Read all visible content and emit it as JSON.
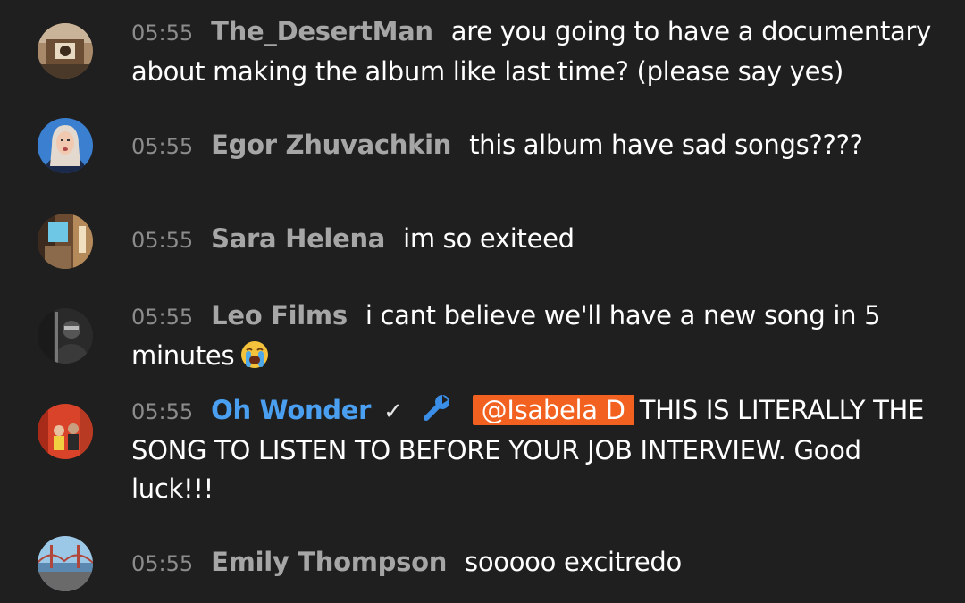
{
  "messages": [
    {
      "time": "05:55",
      "author": "The_DesertMan",
      "text": "are you going to have a documentary about making the album like last time? (please say yes)"
    },
    {
      "time": "05:55",
      "author": "Egor Zhuvachkin",
      "text": "this album have sad songs????"
    },
    {
      "time": "05:55",
      "author": "Sara Helena",
      "text": "im so exiteed"
    },
    {
      "time": "05:55",
      "author": "Leo Films",
      "text": "i cant believe we'll have a new song in 5 minutes",
      "emoji": "loudly-crying-face-icon"
    },
    {
      "time": "05:55",
      "author": "Oh Wonder",
      "verified": "✓",
      "badge": "wrench-icon",
      "mention": "@Isabela D",
      "text": "THIS IS LITERALLY THE SONG TO LISTEN TO BEFORE YOUR JOB INTERVIEW. Good luck!!!"
    },
    {
      "time": "05:55",
      "author": "Emily Thompson",
      "text": "sooooo excitredo"
    }
  ],
  "colors": {
    "background": "#1f1f1f",
    "timestamp": "#8c8c8c",
    "author": "#a6a6a6",
    "owner_author": "#4a9ff0",
    "mention_bg": "#f2611f",
    "message_text": "#ffffff"
  }
}
